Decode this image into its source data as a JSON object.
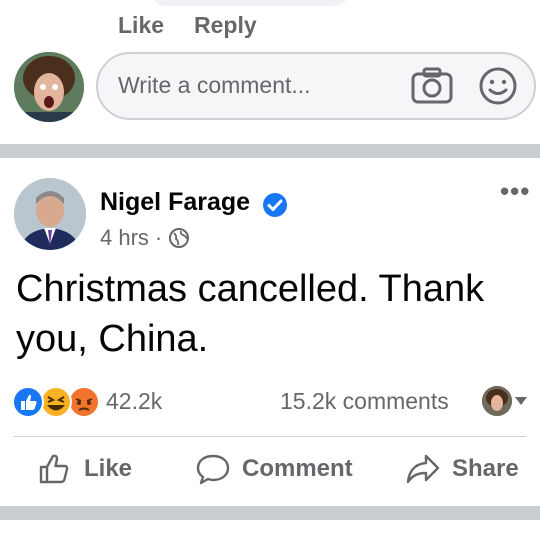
{
  "top_comment_actions": {
    "like": "Like",
    "reply": "Reply"
  },
  "comment_composer": {
    "placeholder": "Write a comment..."
  },
  "post": {
    "author": "Nigel Farage",
    "time": "4 hrs",
    "separator": "·",
    "text": "Christmas cancelled. Thank you, China.",
    "more": "•••",
    "reaction_count": "42.2k",
    "comment_count": "15.2k comments"
  },
  "post_actions": {
    "like": "Like",
    "comment": "Comment",
    "share": "Share"
  },
  "colors": {
    "accent": "#1877f2",
    "muted": "#65676b",
    "divider": "#c9ccd1",
    "angry": "#f0742c",
    "haha": "#f7b125"
  },
  "icons": [
    "camera-icon",
    "smiley-icon",
    "verified-badge-icon",
    "globe-icon",
    "like-reaction-icon",
    "haha-reaction-icon",
    "angry-reaction-icon",
    "caret-down-icon",
    "thumbs-up-icon",
    "comment-icon",
    "share-icon"
  ]
}
